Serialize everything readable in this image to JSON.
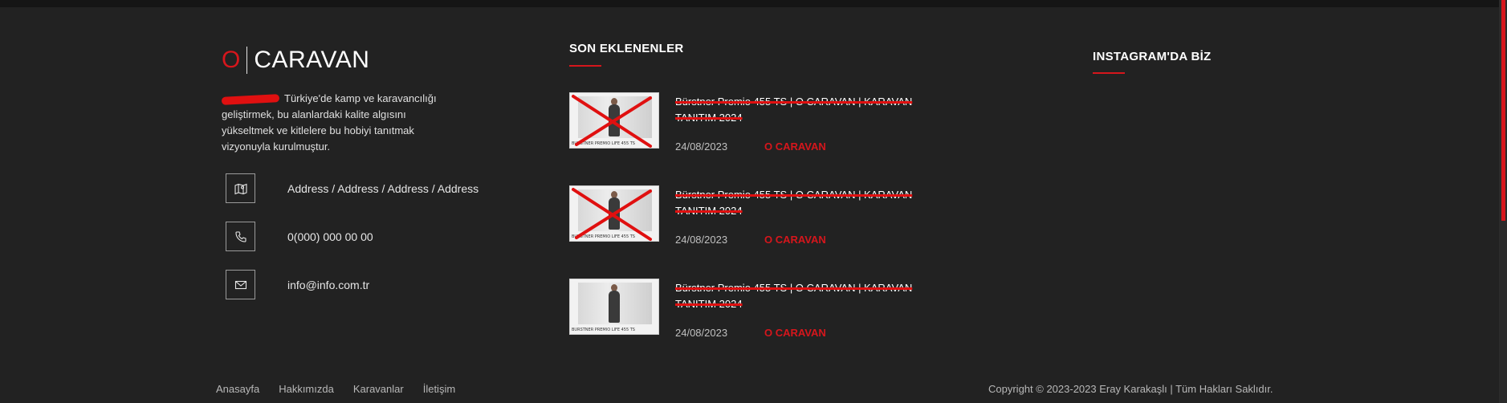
{
  "brand": {
    "logo_letter": "O",
    "logo_name": "CARAVAN",
    "about_text": "Türkiye'de kamp ve karavancılığı geliştirmek, bu alanlardaki kalite algısını yükseltmek ve kitlelere bu hobiyi tanıtmak vizyonuyla kurulmuştur."
  },
  "contact": {
    "address": "Address / Address / Address / Address",
    "phone": "0(000) 000 00 00",
    "email": "info@info.com.tr",
    "icons": [
      "map-icon",
      "phone-icon",
      "mail-icon"
    ]
  },
  "recent": {
    "heading": "SON EKLENENLER",
    "posts": [
      {
        "title": "Bürstner Premio 455 TS | O CARAVAN | KARAVAN TANITIM 2024",
        "date": "24/08/2023",
        "author": "O CARAVAN",
        "thumb_caption": "BURSTNER PREMIO LIFE 455 TS"
      },
      {
        "title": "Bürstner Premio 455 TS | O CARAVAN | KARAVAN TANITIM 2024",
        "date": "24/08/2023",
        "author": "O CARAVAN",
        "thumb_caption": "BURSTNER PREMIO LIFE 455 TS"
      },
      {
        "title": "Bürstner Premio 455 TS | O CARAVAN | KARAVAN TANITIM 2024",
        "date": "24/08/2023",
        "author": "O CARAVAN",
        "thumb_caption": "BURSTNER PREMIO LIFE 455 TS"
      }
    ]
  },
  "instagram": {
    "heading": "INSTAGRAM'DA BİZ"
  },
  "footer": {
    "nav": [
      "Anasayfa",
      "Hakkımızda",
      "Karavanlar",
      "İletişim"
    ],
    "copyright": "Copyright © 2023-2023 Eray Karakaşlı | Tüm Hakları Saklıdır."
  },
  "colors": {
    "accent": "#d6161c",
    "background": "#222222"
  }
}
